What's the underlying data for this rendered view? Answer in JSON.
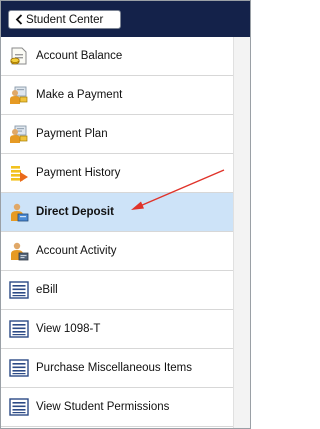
{
  "header": {
    "back_label": "Student Center"
  },
  "menu": {
    "items": [
      {
        "label": "Account Balance",
        "icon": "document-coin-icon"
      },
      {
        "label": "Make a Payment",
        "icon": "payment-person-icon"
      },
      {
        "label": "Payment Plan",
        "icon": "payment-plan-icon"
      },
      {
        "label": "Payment History",
        "icon": "history-stack-icon"
      },
      {
        "label": "Direct Deposit",
        "icon": "deposit-person-icon",
        "selected": true
      },
      {
        "label": "Account Activity",
        "icon": "activity-person-icon"
      },
      {
        "label": "eBill",
        "icon": "list-icon"
      },
      {
        "label": "View 1098-T",
        "icon": "list-icon"
      },
      {
        "label": "Purchase Miscellaneous Items",
        "icon": "list-icon"
      },
      {
        "label": "View Student Permissions",
        "icon": "list-icon"
      }
    ]
  },
  "colors": {
    "header_bg": "#14224a",
    "selected_bg": "#cde3f8",
    "annotation_arrow": "#e0332a"
  }
}
